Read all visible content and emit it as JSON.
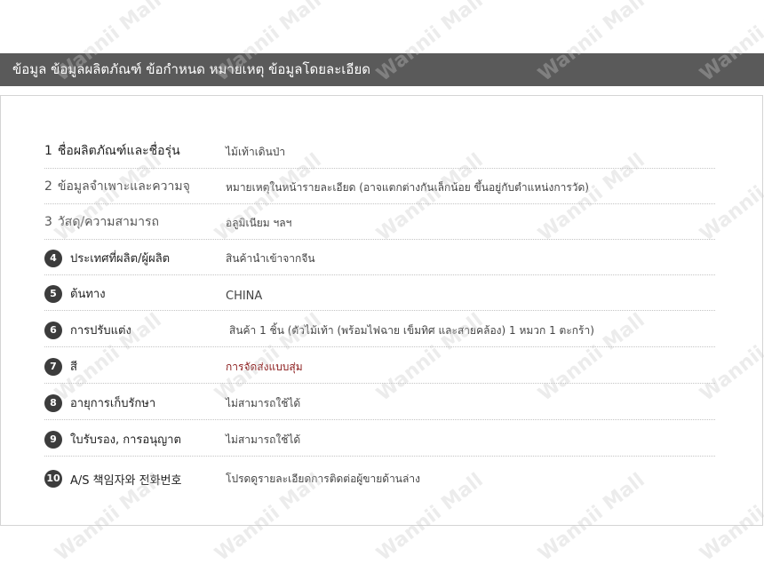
{
  "header": {
    "title": "ข้อมูล ข้อมูลผลิตภัณฑ์ ข้อกำหนด หมายเหตุ ข้อมูลโดยละเอียด"
  },
  "specs": [
    {
      "num": "1",
      "label": "ชื่อผลิตภัณฑ์และชื่อรุ่น",
      "value": "ไม้เท้าเดินป่า"
    },
    {
      "num": "2",
      "label": "ข้อมูลจำเพาะและความจุ",
      "value": "หมายเหตุในหน้ารายละเอียด (อาจแตกต่างกันเล็กน้อย ขึ้นอยู่กับตำแหน่งการวัด)"
    },
    {
      "num": "3",
      "label": "วัสดุ/ความสามารถ",
      "value": "อลูมิเนียม ฯลฯ"
    },
    {
      "num": "4",
      "label": "ประเทศที่ผลิต/ผู้ผลิต",
      "value": "สินค้านำเข้าจากจีน"
    },
    {
      "num": "5",
      "label": "ต้นทาง",
      "value": "CHINA"
    },
    {
      "num": "6",
      "label": "การปรับแต่ง",
      "value": "สินค้า 1 ชิ้น (ตัวไม้เท้า (พร้อมไฟฉาย เข็มทิศ และสายคล้อง) 1 หมวก 1 ตะกร้า)"
    },
    {
      "num": "7",
      "label": "สี",
      "value": "การจัดส่งแบบสุ่ม"
    },
    {
      "num": "8",
      "label": "อายุการเก็บรักษา",
      "value": "ไม่สามารถใช้ได้"
    },
    {
      "num": "9",
      "label": "ใบรับรอง, การอนุญาต",
      "value": "ไม่สามารถใช้ได้"
    },
    {
      "num": "10",
      "label": "A/S 책임자와 전화번호",
      "value": "โปรดดูรายละเอียดการติดต่อผู้ขายด้านล่าง"
    }
  ],
  "watermark": {
    "text": "Wannii Mall",
    "color": "#c8c8c8"
  },
  "colors": {
    "header_bg": "#5a5a5a",
    "badge_bg": "#3c3c3c",
    "accent_value": "#8a1a1a"
  }
}
